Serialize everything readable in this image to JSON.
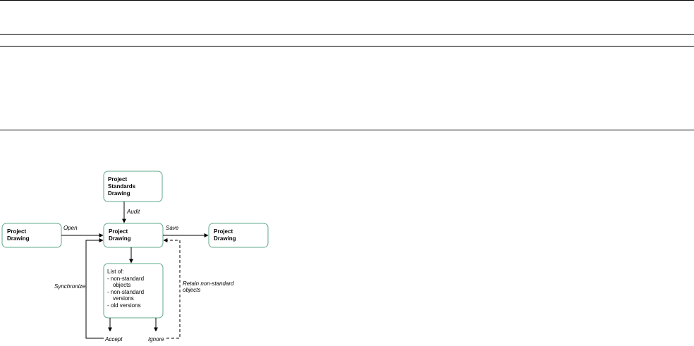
{
  "diagram": {
    "node_border_color": "#5fa889",
    "nodes": {
      "standards": {
        "lines": [
          "Project",
          "Standards",
          "Drawing"
        ]
      },
      "source": {
        "lines": [
          "Project",
          "Drawing"
        ]
      },
      "center": {
        "lines": [
          "Project",
          "Drawing"
        ]
      },
      "target": {
        "lines": [
          "Project",
          "Drawing"
        ]
      },
      "list": {
        "lines": [
          "List of:",
          "- non-standard",
          "objects",
          "- non-standard",
          "versions",
          "- old versions"
        ]
      }
    },
    "edges": {
      "audit": "Audit",
      "open": "Open",
      "save": "Save",
      "synchronize": "Synchronize",
      "retain": [
        "Retain non-standard",
        "objects"
      ],
      "accept": "Accept",
      "ignore": "Ignore"
    }
  }
}
